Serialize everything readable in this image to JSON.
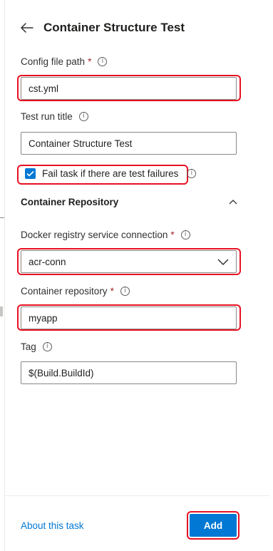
{
  "panel": {
    "title": "Container Structure Test",
    "back_icon": "arrow-left-icon"
  },
  "fields": {
    "config_file_path": {
      "label": "Config file path",
      "required": "*",
      "value": "cst.yml"
    },
    "test_run_title": {
      "label": "Test run title",
      "value": "Container Structure Test"
    },
    "fail_task": {
      "label": "Fail task if there are test failures",
      "checked": true
    },
    "docker_registry": {
      "label": "Docker registry service connection",
      "required": "*",
      "value": "acr-conn"
    },
    "container_repository": {
      "label": "Container repository",
      "required": "*",
      "value": "myapp"
    },
    "tag": {
      "label": "Tag",
      "value": "$(Build.BuildId)"
    }
  },
  "section": {
    "title": "Container Repository",
    "expanded": true
  },
  "footer": {
    "about_link": "About this task",
    "add_button": "Add"
  },
  "colors": {
    "accent": "#0078d4",
    "highlight": "#e81123",
    "required": "#a4262c"
  }
}
